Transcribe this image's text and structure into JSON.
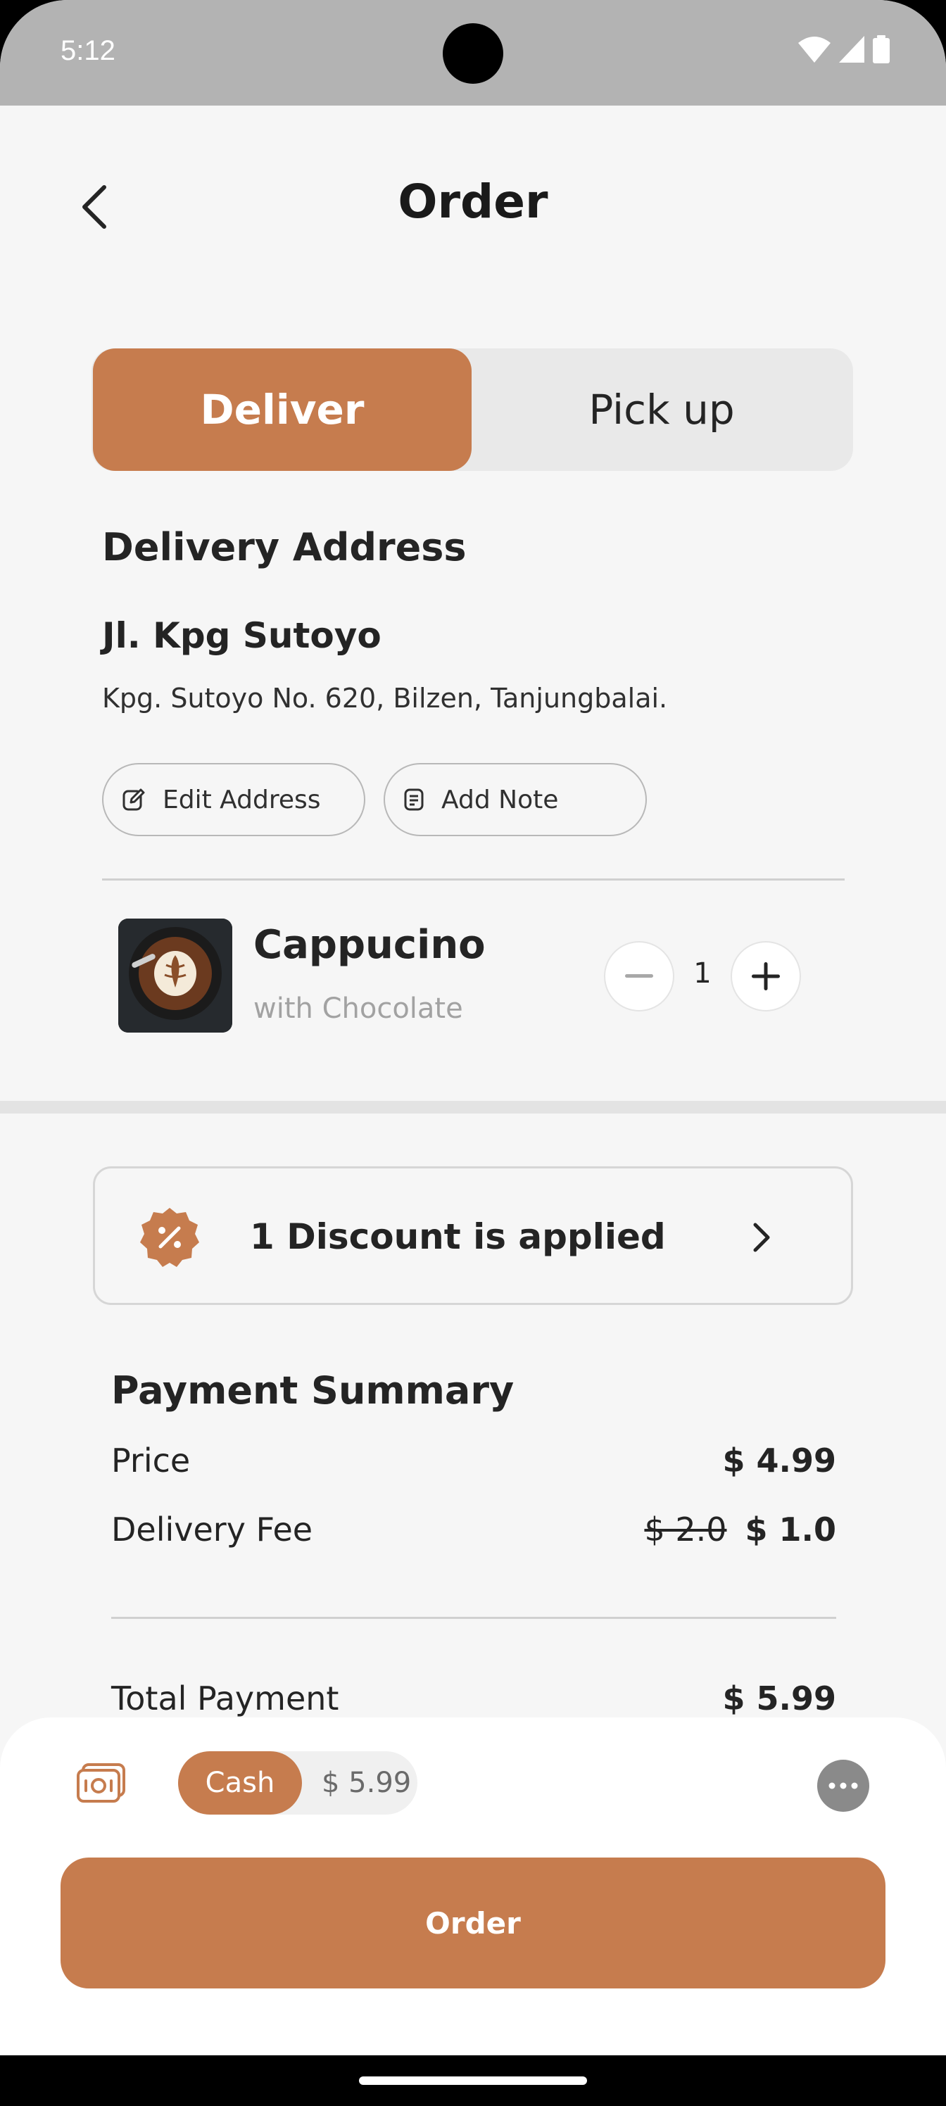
{
  "status_bar": {
    "time": "5:12"
  },
  "header": {
    "title": "Order"
  },
  "segment": {
    "deliver_label": "Deliver",
    "pickup_label": "Pick up",
    "selected": "Deliver"
  },
  "address": {
    "section_title": "Delivery Address",
    "title": "Jl. Kpg Sutoyo",
    "detail": "Kpg. Sutoyo No. 620, Bilzen, Tanjungbalai.",
    "edit_label": "Edit Address",
    "note_label": "Add Note"
  },
  "product": {
    "name": "Cappucino",
    "subtitle": "with Chocolate",
    "quantity": "1"
  },
  "discount": {
    "label": "1 Discount is applied"
  },
  "payment": {
    "section_title": "Payment Summary",
    "price_label": "Price",
    "price_value": "$ 4.99",
    "delivery_label": "Delivery Fee",
    "delivery_original": "$ 2.0",
    "delivery_value": "$ 1.0",
    "total_label": "Total Payment",
    "total_value": "$ 5.99"
  },
  "checkout": {
    "method": "Cash",
    "amount": "$ 5.99",
    "order_label": "Order"
  },
  "colors": {
    "accent": "#C67C4E",
    "background": "#F6F6F6",
    "status_bar": "#B3B3B3"
  }
}
